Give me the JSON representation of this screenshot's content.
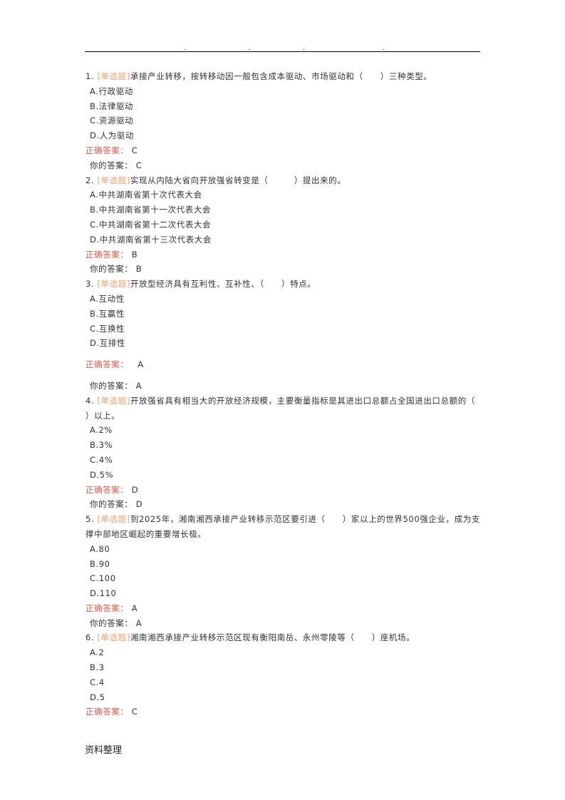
{
  "header": {
    "dots": [
      ".",
      ".",
      ".",
      "."
    ]
  },
  "labels": {
    "type_tag": "[单选题]",
    "correct_answer": "正确答案：",
    "your_answer": "你的答案："
  },
  "questions": [
    {
      "number": "1.",
      "text": "承接产业转移，按转移动因一般包含成本驱动、市场驱动和（　　）三种类型。",
      "options": [
        "A.行政驱动",
        "B.法律驱动",
        "C.资源驱动",
        "D.人为驱动"
      ],
      "correct": "C",
      "yours": "C"
    },
    {
      "number": "2.",
      "text": "实现从内陆大省向开放强省转变是（　　　）提出来的。",
      "options": [
        "A.中共湖南省第十次代表大会",
        "B.中共湖南省第十一次代表大会",
        "C.中共湖南省第十二次代表大会",
        "D.中共湖南省第十三次代表大会"
      ],
      "correct": "B",
      "yours": "B"
    },
    {
      "number": "3.",
      "text": "开放型经济具有互利性、互补性、（　　）特点。",
      "options": [
        "A.互动性",
        "B.互赢性",
        "C.互换性",
        "D.互排性"
      ],
      "correct": "A",
      "yours": "A"
    },
    {
      "number": "4.",
      "text": "开放强省具有相当大的开放经济规模，主要衡量指标是其进出口总额占全国进出口总额的（　　　）以上。",
      "options": [
        "A.2%",
        "B.3%",
        "C.4%",
        "D.5%"
      ],
      "correct": "D",
      "yours": "D"
    },
    {
      "number": "5.",
      "text": "到2025年，湘南湘西承接产业转移示范区要引进（　　）家以上的世界500强企业，成为支撑中部地区崛起的重要增长极。",
      "options": [
        "A.80",
        "B.90",
        "C.100",
        "D.110"
      ],
      "correct": "A",
      "yours": "A"
    },
    {
      "number": "6.",
      "text": "湘南湘西承接产业转移示范区现有衡阳南岳、永州零陵等（　　）座机场。",
      "options": [
        "A.2",
        "B.3",
        "C.4",
        "D.5"
      ],
      "correct": "C",
      "yours": null
    }
  ],
  "footer": {
    "text": "资料整理"
  },
  "colors": {
    "tag": "#f0a070",
    "correct_label": "#e05a4a",
    "text": "#333333"
  }
}
